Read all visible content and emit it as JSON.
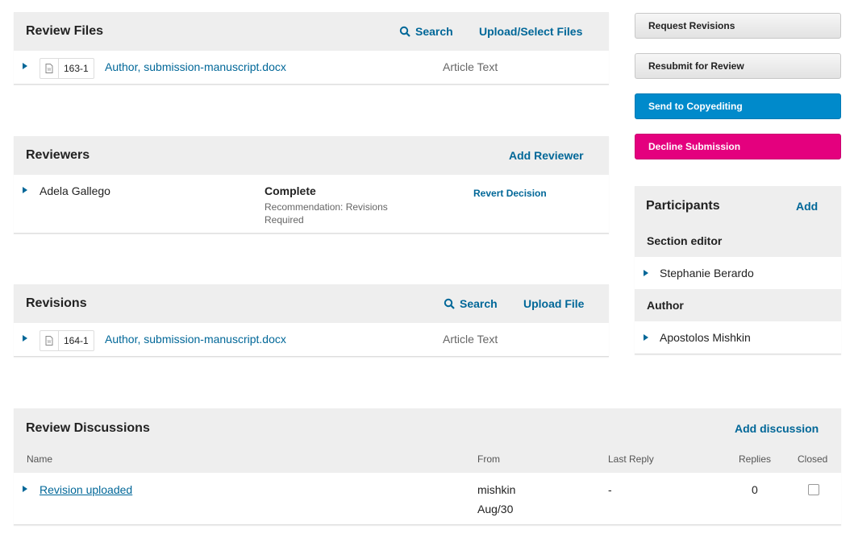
{
  "review_files": {
    "title": "Review Files",
    "search_label": "Search",
    "upload_label": "Upload/Select Files",
    "file": {
      "id": "163-1",
      "name": "Author, submission-manuscript.docx",
      "type": "Article Text"
    }
  },
  "reviewers": {
    "title": "Reviewers",
    "add_label": "Add Reviewer",
    "reviewer": {
      "name": "Adela Gallego",
      "status": "Complete",
      "recommendation": "Recommendation: Revisions Required",
      "action": "Revert Decision"
    }
  },
  "revisions": {
    "title": "Revisions",
    "search_label": "Search",
    "upload_label": "Upload File",
    "file": {
      "id": "164-1",
      "name": "Author, submission-manuscript.docx",
      "type": "Article Text"
    }
  },
  "discussions": {
    "title": "Review Discussions",
    "add_label": "Add discussion",
    "columns": {
      "name": "Name",
      "from": "From",
      "last_reply": "Last Reply",
      "replies": "Replies",
      "closed": "Closed"
    },
    "row": {
      "name": "Revision uploaded",
      "from_user": "mishkin",
      "from_date": "Aug/30",
      "last_reply": "-",
      "replies": "0"
    }
  },
  "actions": {
    "request_revisions": "Request Revisions",
    "resubmit": "Resubmit for Review",
    "copyediting": "Send to Copyediting",
    "decline": "Decline Submission"
  },
  "participants": {
    "title": "Participants",
    "add_label": "Add",
    "section_editor_label": "Section editor",
    "section_editor": "Stephanie Berardo",
    "author_label": "Author",
    "author": "Apostolos Mishkin"
  },
  "colors": {
    "link": "#006798",
    "primary": "#008acb",
    "danger": "#e4007e"
  },
  "icons": [
    "search-icon",
    "docx-file-icon",
    "caret-right-icon",
    "checkbox"
  ]
}
